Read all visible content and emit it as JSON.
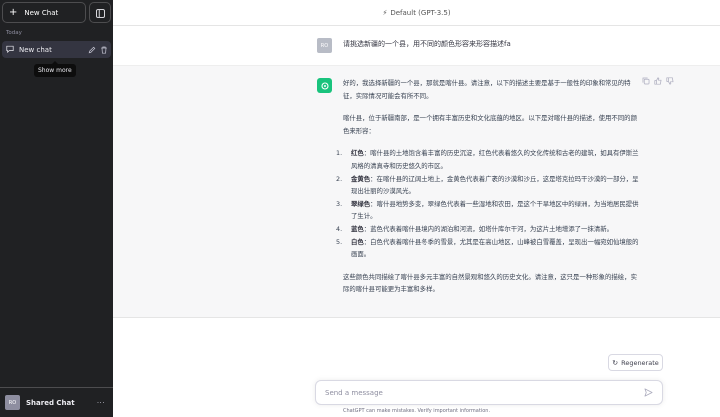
{
  "sidebar": {
    "new_chat_label": "New Chat",
    "section_today": "Today",
    "chat_item_label": "New chat",
    "tooltip": "Show more",
    "footer_avatar": "RO",
    "footer_name": "Shared Chat",
    "footer_more": "···"
  },
  "header": {
    "model_label": "Default (GPT-3.5)"
  },
  "conversation": {
    "user_avatar": "RO",
    "user_message": "请挑选新疆的一个县，用不同的颜色形容来形容描述fa",
    "assistant": {
      "intro": "好的，我选择新疆的一个县，那就是喀什县。请注意，以下的描述主要是基于一般性的印象和常见的特征，实际情况可能会有所不同。",
      "para2": "喀什县，位于新疆南部，是一个拥有丰富历史和文化底蕴的地区。以下是对喀什县的描述，使用不同的颜色来形容：",
      "items": [
        {
          "num": "1.",
          "color": "红色",
          "text": "：喀什县的土地饱含着丰富的历史沉淀，红色代表着悠久的文化传统和古老的建筑，如具有伊斯兰风格的清真寺和历史悠久的市区。"
        },
        {
          "num": "2.",
          "color": "金黄色",
          "text": "：在喀什县的辽阔土地上，金黄色代表着广袤的沙漠和沙丘，这是塔克拉玛干沙漠的一部分，呈现出壮丽的沙漠风光。"
        },
        {
          "num": "3.",
          "color": "翠绿色",
          "text": "：喀什县地势多变，翠绿色代表着一些湿地和农田，是这个干旱地区中的绿洲，为当地居民提供了生计。"
        },
        {
          "num": "4.",
          "color": "蓝色",
          "text": "：蓝色代表着喀什县境内的湖泊和河流，如塔什库尔干河，为这片土地增添了一抹清新。"
        },
        {
          "num": "5.",
          "color": "白色",
          "text": "：白色代表着喀什县冬季的雪景，尤其是在高山地区，山峰被白雪覆盖，呈现出一幅宛如仙境般的画面。"
        }
      ],
      "outro": "这些颜色共同描绘了喀什县多元丰富的自然景观和悠久的历史文化。请注意，这只是一种形象的描绘，实际的喀什县可能更为丰富和多样。"
    }
  },
  "composer": {
    "regenerate_label": "Regenerate",
    "input_placeholder": "Send a message",
    "disclaimer": "ChatGPT can make mistakes. Verify important information."
  },
  "colors": {
    "sidebar_bg": "#202123",
    "assistant_bg": "#f7f7f8",
    "gpt_icon": "#19c37d"
  }
}
